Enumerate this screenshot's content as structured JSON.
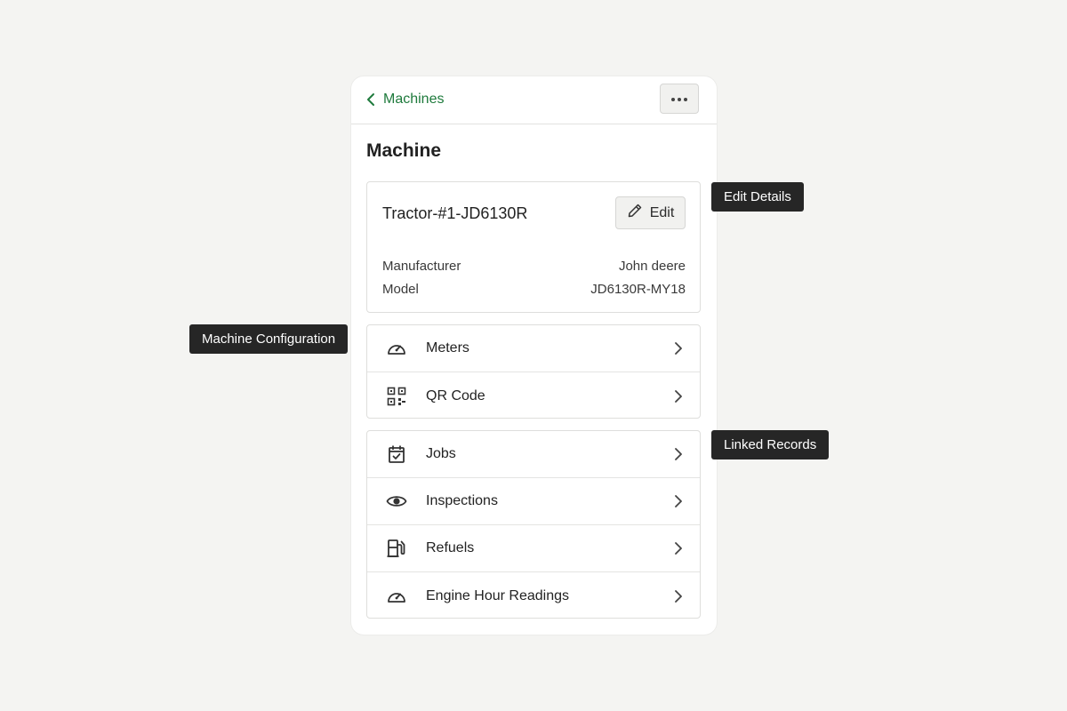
{
  "header": {
    "back_label": "Machines",
    "more_icon": "ellipsis-icon"
  },
  "page": {
    "title": "Machine"
  },
  "details": {
    "name": "Tractor-#1-JD6130R",
    "edit_label": "Edit",
    "fields": [
      {
        "label": "Manufacturer",
        "value": "John deere"
      },
      {
        "label": "Model",
        "value": "JD6130R-MY18"
      }
    ]
  },
  "configuration": {
    "items": [
      {
        "label": "Meters",
        "icon": "gauge-icon"
      },
      {
        "label": "QR Code",
        "icon": "qr-code-icon"
      }
    ]
  },
  "linked_records": {
    "items": [
      {
        "label": "Jobs",
        "icon": "calendar-check-icon"
      },
      {
        "label": "Inspections",
        "icon": "eye-icon"
      },
      {
        "label": "Refuels",
        "icon": "fuel-pump-icon"
      },
      {
        "label": "Engine Hour Readings",
        "icon": "gauge-icon"
      }
    ]
  },
  "annotations": {
    "edit_details": "Edit Details",
    "machine_configuration": "Machine Configuration",
    "linked_records": "Linked Records"
  },
  "colors": {
    "accent": "#1e7a3c",
    "background": "#f4f4f2",
    "tooltip": "#262626"
  }
}
